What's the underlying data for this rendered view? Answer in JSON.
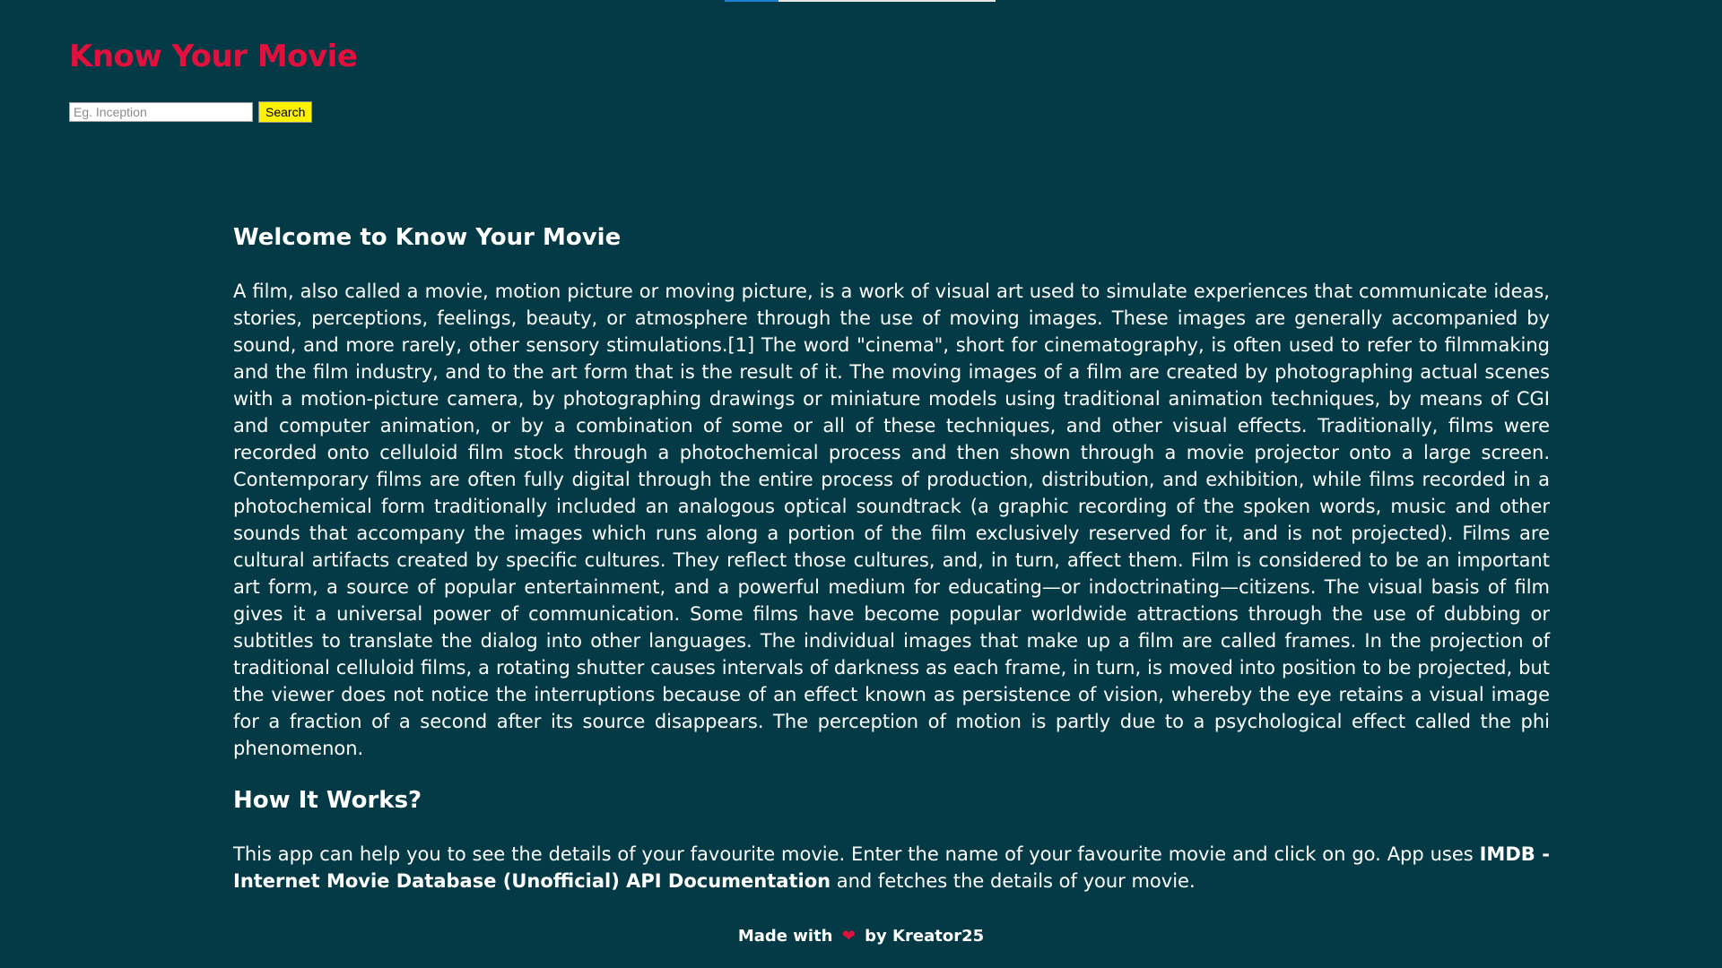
{
  "header": {
    "title": "Know Your Movie",
    "progress": 0.2
  },
  "search": {
    "placeholder": "Eg. Inception",
    "value": "",
    "button_label": "Search"
  },
  "main": {
    "welcome_heading": "Welcome to Know Your Movie",
    "intro_paragraph": "A film, also called a movie, motion picture or moving picture, is a work of visual art used to simulate experiences that communicate ideas, stories, perceptions, feelings, beauty, or atmosphere through the use of moving images. These images are generally accompanied by sound, and more rarely, other sensory stimulations.[1] The word \"cinema\", short for cinematography, is often used to refer to filmmaking and the film industry, and to the art form that is the result of it. The moving images of a film are created by photographing actual scenes with a motion-picture camera, by photographing drawings or miniature models using traditional animation techniques, by means of CGI and computer animation, or by a combination of some or all of these techniques, and other visual effects. Traditionally, films were recorded onto celluloid film stock through a photochemical process and then shown through a movie projector onto a large screen. Contemporary films are often fully digital through the entire process of production, distribution, and exhibition, while films recorded in a photochemical form traditionally included an analogous optical soundtrack (a graphic recording of the spoken words, music and other sounds that accompany the images which runs along a portion of the film exclusively reserved for it, and is not projected). Films are cultural artifacts created by specific cultures. They reflect those cultures, and, in turn, affect them. Film is considered to be an important art form, a source of popular entertainment, and a powerful medium for educating—or indoctrinating—citizens. The visual basis of film gives it a universal power of communication. Some films have become popular worldwide attractions through the use of dubbing or subtitles to translate the dialog into other languages. The individual images that make up a film are called frames. In the projection of traditional celluloid films, a rotating shutter causes intervals of darkness as each frame, in turn, is moved into position to be projected, but the viewer does not notice the interruptions because of an effect known as persistence of vision, whereby the eye retains a visual image for a fraction of a second after its source disappears. The perception of motion is partly due to a psychological effect called the phi phenomenon.",
    "how_heading": "How It Works?",
    "how_text_before": "This app can help you to see the details of your favourite movie. Enter the name of your favourite movie and click on go. App uses ",
    "how_bold": "IMDB - Internet Movie Database (Unofficial) API Documentation",
    "how_text_after": " and fetches the details of your movie."
  },
  "footer": {
    "made_with": "Made with",
    "heart_icon": "heart-icon",
    "by": "by Kreator25"
  },
  "colors": {
    "background": "#033a45",
    "title": "#e1103d",
    "button": "#fff200",
    "text": "#ffffff"
  }
}
